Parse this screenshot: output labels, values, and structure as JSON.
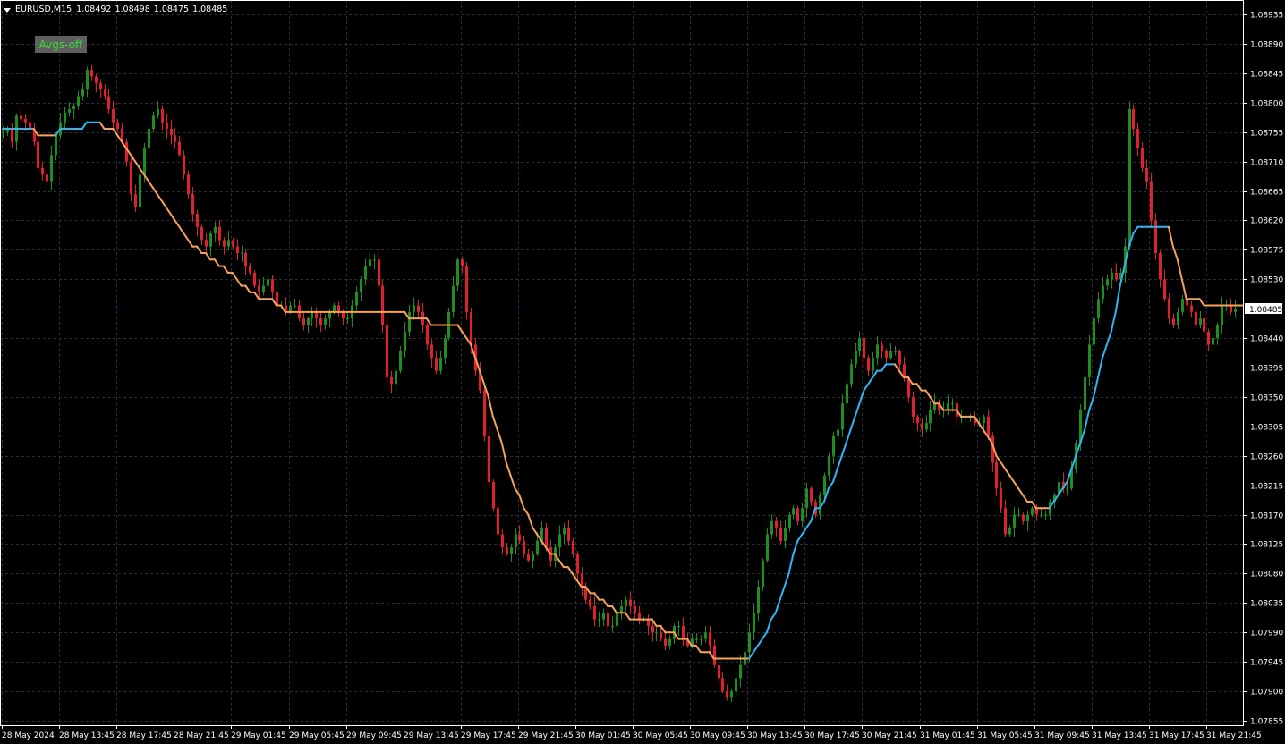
{
  "header": {
    "symbol": "EURUSD,M15",
    "open": "1.08492",
    "high": "1.08498",
    "low": "1.08475",
    "close": "1.08485"
  },
  "avgs_button": {
    "label": "Avgs-off"
  },
  "colors": {
    "background": "#000000",
    "grid": "#2a2f38",
    "bull": "#1e8e1e",
    "bear": "#e0202e",
    "ma_up": "#2eb6f5",
    "ma_down": "#f7a25c",
    "axis_text": "#ffffff",
    "price_tag_bg": "#ffffff",
    "price_tag_text": "#000000"
  },
  "price_axis_labels": [
    "1.08935",
    "1.08890",
    "1.08845",
    "1.08800",
    "1.08755",
    "1.08710",
    "1.08665",
    "1.08620",
    "1.08575",
    "1.08530",
    "1.08440",
    "1.08395",
    "1.08350",
    "1.08305",
    "1.08260",
    "1.08215",
    "1.08170",
    "1.08125",
    "1.08080",
    "1.08035",
    "1.07990",
    "1.07945",
    "1.07900",
    "1.07855"
  ],
  "current_price_label": "1.08485",
  "time_axis_labels": [
    "28 May 2024",
    "28 May 13:45",
    "28 May 17:45",
    "28 May 21:45",
    "29 May 01:45",
    "29 May 05:45",
    "29 May 09:45",
    "29 May 13:45",
    "29 May 17:45",
    "29 May 21:45",
    "30 May 01:45",
    "30 May 05:45",
    "30 May 09:45",
    "30 May 13:45",
    "30 May 17:45",
    "30 May 21:45",
    "31 May 01:45",
    "31 May 05:45",
    "31 May 09:45",
    "31 May 13:45",
    "31 May 17:45",
    "31 May 21:45"
  ],
  "chart_data": {
    "type": "candlestick",
    "symbol": "EURUSD",
    "timeframe": "M15",
    "ylim": [
      1.0785,
      1.0895
    ],
    "grid": true,
    "price_series": {
      "name": "EURUSD M15",
      "values": [
        1.08755,
        1.0876,
        1.0874,
        1.0878,
        1.08775,
        1.0877,
        1.0876,
        1.0874,
        1.087,
        1.0869,
        1.0868,
        1.0872,
        1.0875,
        1.0877,
        1.08785,
        1.0879,
        1.08795,
        1.0881,
        1.0882,
        1.0885,
        1.0884,
        1.0883,
        1.0882,
        1.0881,
        1.0879,
        1.0877,
        1.0876,
        1.0874,
        1.0871,
        1.0866,
        1.0864,
        1.0869,
        1.0873,
        1.0876,
        1.0878,
        1.0879,
        1.0877,
        1.0876,
        1.0875,
        1.0874,
        1.0872,
        1.0869,
        1.0866,
        1.0863,
        1.0861,
        1.0859,
        1.0858,
        1.086,
        1.0861,
        1.0859,
        1.0858,
        1.0859,
        1.0858,
        1.0857,
        1.0857,
        1.0855,
        1.0854,
        1.0852,
        1.0851,
        1.0852,
        1.0853,
        1.0851,
        1.0849,
        1.0849,
        1.0848,
        1.0849,
        1.0849,
        1.0847,
        1.0846,
        1.0847,
        1.0848,
        1.0847,
        1.0846,
        1.0847,
        1.0848,
        1.0849,
        1.0848,
        1.0847,
        1.0847,
        1.0849,
        1.0851,
        1.0853,
        1.0855,
        1.0856,
        1.0856,
        1.0852,
        1.0846,
        1.0838,
        1.0837,
        1.0839,
        1.0842,
        1.0845,
        1.0848,
        1.0849,
        1.0848,
        1.0846,
        1.0843,
        1.0841,
        1.0839,
        1.0841,
        1.0844,
        1.0848,
        1.0852,
        1.0856,
        1.0855,
        1.0848,
        1.0843,
        1.0839,
        1.0836,
        1.0829,
        1.0822,
        1.0818,
        1.0814,
        1.0812,
        1.0811,
        1.0812,
        1.0814,
        1.0813,
        1.0811,
        1.081,
        1.0811,
        1.0813,
        1.0815,
        1.0812,
        1.081,
        1.0812,
        1.0814,
        1.0815,
        1.0813,
        1.0811,
        1.0808,
        1.0806,
        1.0804,
        1.0803,
        1.0801,
        1.0801,
        1.0802,
        1.08,
        1.08,
        1.0802,
        1.0803,
        1.0804,
        1.0803,
        1.0802,
        1.0801,
        1.0801,
        1.08,
        1.0799,
        1.0799,
        1.0798,
        1.0797,
        1.0798,
        1.08,
        1.08,
        1.0798,
        1.0797,
        1.0798,
        1.0798,
        1.0798,
        1.0799,
        1.0797,
        1.0794,
        1.0792,
        1.079,
        1.0789,
        1.079,
        1.0792,
        1.0794,
        1.0796,
        1.0799,
        1.0802,
        1.0806,
        1.081,
        1.0814,
        1.0816,
        1.0815,
        1.0813,
        1.0815,
        1.0817,
        1.0818,
        1.0816,
        1.0818,
        1.0821,
        1.0819,
        1.0817,
        1.082,
        1.0823,
        1.0826,
        1.0829,
        1.083,
        1.0834,
        1.0837,
        1.084,
        1.0842,
        1.0844,
        1.0841,
        1.0839,
        1.0841,
        1.0843,
        1.0842,
        1.0841,
        1.0842,
        1.0842,
        1.084,
        1.0838,
        1.0835,
        1.0832,
        1.0831,
        1.083,
        1.0831,
        1.0833,
        1.0834,
        1.0833,
        1.0833,
        1.0834,
        1.0834,
        1.0832,
        1.0832,
        1.0832,
        1.0832,
        1.0831,
        1.0831,
        1.0832,
        1.0829,
        1.0825,
        1.0821,
        1.0818,
        1.0814,
        1.0815,
        1.0817,
        1.0817,
        1.0816,
        1.0817,
        1.0818,
        1.0817,
        1.0817,
        1.0817,
        1.0819,
        1.082,
        1.0822,
        1.0821,
        1.0821,
        1.0824,
        1.0828,
        1.0833,
        1.0838,
        1.0843,
        1.0847,
        1.085,
        1.0852,
        1.0853,
        1.0854,
        1.0853,
        1.0854,
        1.0858,
        1.0879,
        1.0876,
        1.0873,
        1.087,
        1.0868,
        1.0862,
        1.0857,
        1.0853,
        1.085,
        1.0847,
        1.0846,
        1.0848,
        1.085,
        1.0849,
        1.0848,
        1.0846,
        1.0847,
        1.0845,
        1.0843,
        1.0844,
        1.0846,
        1.0849,
        1.0849,
        1.0848,
        1.08485
      ]
    },
    "moving_average": {
      "values": [
        1.0876,
        1.0876,
        1.0876,
        1.0876,
        1.0876,
        1.0876,
        1.0876,
        1.0876,
        1.0875,
        1.0875,
        1.0875,
        1.0875,
        1.0875,
        1.0876,
        1.0876,
        1.0876,
        1.0876,
        1.0876,
        1.0876,
        1.0877,
        1.0877,
        1.0877,
        1.0877,
        1.0876,
        1.0876,
        1.0876,
        1.0875,
        1.0874,
        1.0873,
        1.0872,
        1.0871,
        1.087,
        1.0869,
        1.0868,
        1.0867,
        1.0866,
        1.0865,
        1.0864,
        1.0863,
        1.0862,
        1.0861,
        1.086,
        1.0859,
        1.0858,
        1.0858,
        1.0857,
        1.0857,
        1.0856,
        1.0856,
        1.0855,
        1.0855,
        1.0854,
        1.0854,
        1.0853,
        1.0852,
        1.0852,
        1.0851,
        1.0851,
        1.085,
        1.085,
        1.085,
        1.085,
        1.0849,
        1.0849,
        1.0848,
        1.0848,
        1.0848,
        1.0848,
        1.0848,
        1.0848,
        1.0848,
        1.0848,
        1.0848,
        1.0848,
        1.0848,
        1.0848,
        1.0848,
        1.0848,
        1.0848,
        1.0848,
        1.0848,
        1.0848,
        1.0848,
        1.0848,
        1.0848,
        1.0848,
        1.0848,
        1.0848,
        1.0848,
        1.0848,
        1.0848,
        1.0848,
        1.0847,
        1.0847,
        1.0847,
        1.0847,
        1.0847,
        1.0846,
        1.0846,
        1.0846,
        1.0846,
        1.0846,
        1.0846,
        1.0846,
        1.0845,
        1.0844,
        1.0843,
        1.0841,
        1.0839,
        1.0837,
        1.0835,
        1.0832,
        1.083,
        1.0828,
        1.0825,
        1.0823,
        1.0821,
        1.082,
        1.0818,
        1.0817,
        1.0815,
        1.0814,
        1.0813,
        1.0812,
        1.0811,
        1.0811,
        1.081,
        1.0809,
        1.0809,
        1.0808,
        1.0807,
        1.0806,
        1.0806,
        1.0805,
        1.0805,
        1.0804,
        1.0804,
        1.0803,
        1.0803,
        1.0802,
        1.0802,
        1.0802,
        1.0801,
        1.0801,
        1.0801,
        1.0801,
        1.0801,
        1.0801,
        1.08,
        1.08,
        1.0799,
        1.0799,
        1.0799,
        1.0798,
        1.0798,
        1.0798,
        1.0797,
        1.0797,
        1.0796,
        1.0796,
        1.0796,
        1.0795,
        1.0795,
        1.0795,
        1.0795,
        1.0795,
        1.0795,
        1.0795,
        1.0795,
        1.0795,
        1.0796,
        1.0797,
        1.0798,
        1.0799,
        1.0801,
        1.0802,
        1.0804,
        1.0806,
        1.0808,
        1.0811,
        1.0813,
        1.0814,
        1.0815,
        1.0816,
        1.0818,
        1.0818,
        1.0819,
        1.0821,
        1.0822,
        1.0824,
        1.0826,
        1.0828,
        1.083,
        1.0832,
        1.0834,
        1.0836,
        1.0837,
        1.0838,
        1.0839,
        1.0839,
        1.084,
        1.084,
        1.084,
        1.0839,
        1.0838,
        1.0838,
        1.0837,
        1.0837,
        1.0836,
        1.0836,
        1.0835,
        1.0834,
        1.0834,
        1.0833,
        1.0833,
        1.0833,
        1.0833,
        1.0832,
        1.0832,
        1.0832,
        1.0832,
        1.0831,
        1.083,
        1.0829,
        1.0828,
        1.0826,
        1.0825,
        1.0824,
        1.0823,
        1.0822,
        1.0821,
        1.082,
        1.0819,
        1.0819,
        1.0818,
        1.0818,
        1.0818,
        1.0818,
        1.0819,
        1.082,
        1.0821,
        1.0822,
        1.0824,
        1.0826,
        1.0828,
        1.083,
        1.0833,
        1.0835,
        1.0838,
        1.0841,
        1.0843,
        1.0845,
        1.0848,
        1.0852,
        1.0855,
        1.0858,
        1.086,
        1.0861,
        1.0861,
        1.0861,
        1.0861,
        1.0861,
        1.0861,
        1.0861,
        1.0861,
        1.0858,
        1.0856,
        1.0853,
        1.085,
        1.085,
        1.085,
        1.085,
        1.0849,
        1.0849,
        1.0849,
        1.0849,
        1.0849,
        1.0849,
        1.0849,
        1.0849,
        1.0849,
        1.0849,
        1.0849
      ]
    },
    "current_price": 1.08485
  }
}
